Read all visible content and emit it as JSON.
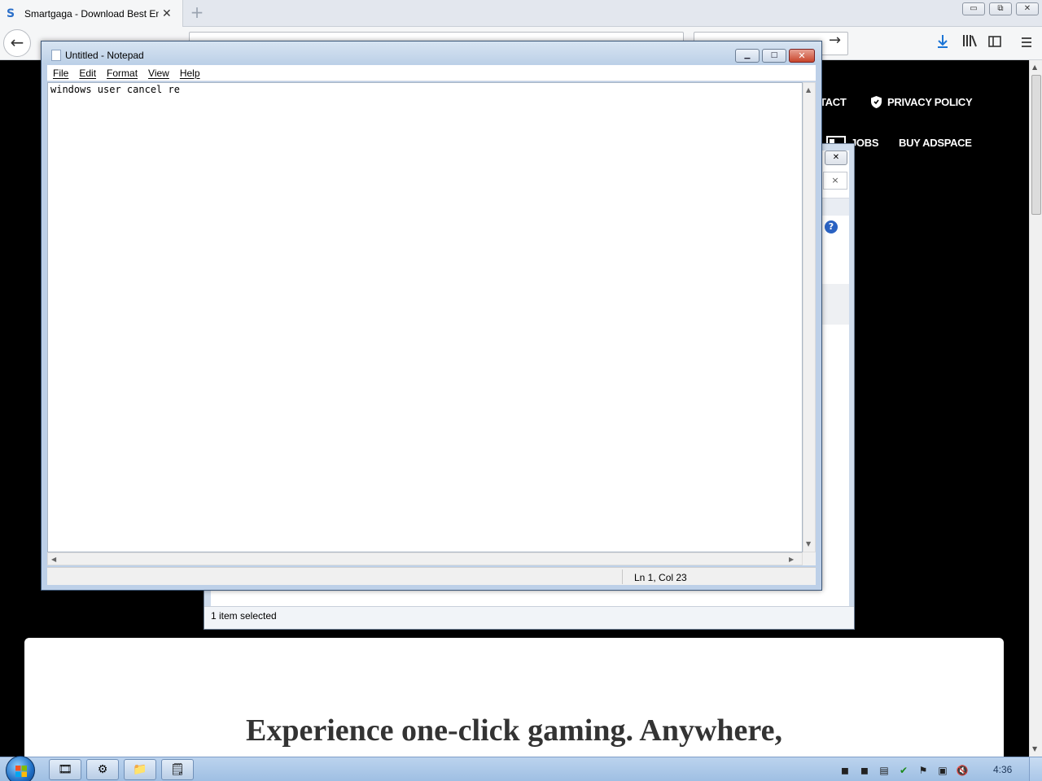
{
  "browser": {
    "tab_title": "Smartgaga - Download Best Em",
    "tab_close": "✕",
    "new_tab": "+",
    "window_controls": {
      "minimize": "▭",
      "restore": "⧉",
      "close": "✕"
    },
    "back_icon": "←",
    "go_icon": "→",
    "toolbar_icons": [
      "download-icon",
      "library-icon",
      "sidebar-icon",
      "menu-icon"
    ]
  },
  "webpage": {
    "nav": {
      "contact": "TACT",
      "privacy": "PRIVACY POLICY",
      "jobs": "JOBS",
      "buy_adspace": "BUY ADSPACE"
    },
    "hero_text": "Experience one-click gaming. Anywhere,"
  },
  "explorer": {
    "close_glyph": "✕",
    "x_glyph": "×",
    "help_glyph": "?",
    "status": "1 item selected"
  },
  "notepad": {
    "title": "Untitled - Notepad",
    "menu": {
      "file": "File",
      "edit": "Edit",
      "format": "Format",
      "view": "View",
      "help": "Help"
    },
    "content": "windows user cancel re",
    "status_position": "Ln 1, Col 23",
    "controls": {
      "minimize": "▁",
      "maximize": "□",
      "close": "✕"
    }
  },
  "taskbar": {
    "clock": "4:36",
    "buttons": [
      "media-player-icon",
      "settings-icon",
      "explorer-icon",
      "notepad-icon"
    ]
  }
}
